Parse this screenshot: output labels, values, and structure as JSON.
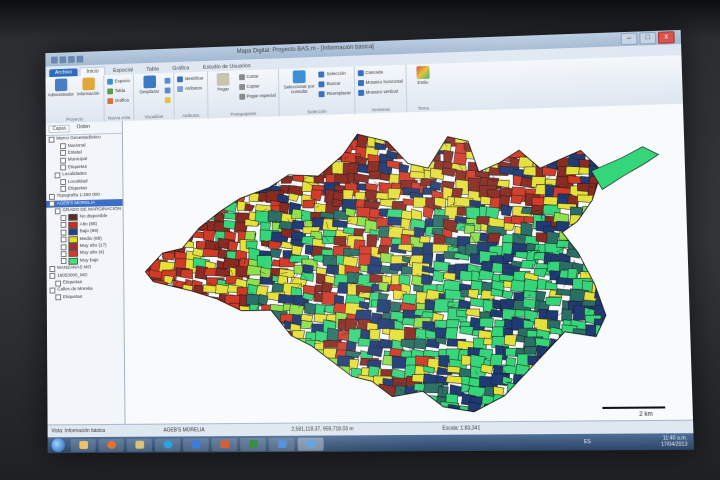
{
  "window": {
    "title": "Mapa Digital: Proyecto BAS.m - [Información básica]",
    "controls": {
      "minimize": "–",
      "maximize": "□",
      "close": "x"
    }
  },
  "ribbon_tabs": [
    "Archivo",
    "Inicio",
    "Espacial",
    "Tabla",
    "Gráfica",
    "Estudio de Usuarios"
  ],
  "ribbon": {
    "groups": [
      {
        "name": "Proyecto",
        "buttons": [
          "Administrador",
          "Información"
        ]
      },
      {
        "name": "Nueva vista",
        "buttons": [
          "Espacio",
          "Tabla",
          "Gráfica"
        ]
      },
      {
        "name": "Visualizar",
        "buttons": [
          "Desplazar"
        ]
      },
      {
        "name": "Atributos",
        "buttons": [
          "Identificar",
          "Atributos"
        ]
      },
      {
        "name": "Portapapeles",
        "buttons": [
          "Pegar",
          "Cortar",
          "Copiar",
          "Pegar especial"
        ]
      },
      {
        "name": "Selección",
        "buttons": [
          "Seleccionar por consulta",
          "Selección",
          "Buscar",
          "Reemplazar"
        ]
      },
      {
        "name": "Ventanas",
        "buttons": [
          "Cascada",
          "Mosaico horizontal",
          "Mosaico vertical"
        ]
      },
      {
        "name": "Tema",
        "buttons": [
          "Estilo"
        ]
      }
    ]
  },
  "toc": {
    "tabs": [
      "Capas",
      "Orden"
    ],
    "items": [
      {
        "label": "Marco Geoestadístico",
        "level": 0
      },
      {
        "label": "Nacional",
        "level": 2
      },
      {
        "label": "Estatal",
        "level": 2
      },
      {
        "label": "Municipal",
        "level": 2
      },
      {
        "label": "Etiquetas",
        "level": 2
      },
      {
        "label": "Localidades",
        "level": 1
      },
      {
        "label": "Localidad",
        "level": 2
      },
      {
        "label": "Etiquetas",
        "level": 2
      },
      {
        "label": "Topografía 1:250 000",
        "level": 0
      },
      {
        "label": "AGEB'S MORELIA",
        "level": 0,
        "selected": true
      },
      {
        "label": "GRADO DE MARGINACIÓN",
        "level": 1
      },
      {
        "label": "No disponible",
        "level": 2,
        "color": "#5a2a2a"
      },
      {
        "label": "Alto (88)",
        "level": 2,
        "color": "#d42a1f"
      },
      {
        "label": "Bajo (89)",
        "level": 2,
        "color": "#1f3f8c"
      },
      {
        "label": "Medio (88)",
        "level": 2,
        "color": "#e8de1e"
      },
      {
        "label": "Muy alto (17)",
        "level": 2,
        "color": "#b2282e"
      },
      {
        "label": "Muy alto (4)",
        "level": 2,
        "color": "#d83a2a"
      },
      {
        "label": "Muy bajo",
        "level": 2,
        "color": "#46e07a"
      },
      {
        "label": "MANZANAS MO",
        "level": 0
      },
      {
        "label": "16053000_MO",
        "level": 0
      },
      {
        "label": "Etiquetas",
        "level": 1
      },
      {
        "label": "Calles de Morelia",
        "level": 0
      },
      {
        "label": "Etiquetas",
        "level": 1
      }
    ]
  },
  "map": {
    "colors": {
      "dark_red": "#8a2a22",
      "red": "#d23a28",
      "yellow": "#e6e03a",
      "green": "#35d67a",
      "lime": "#8fe04a",
      "navy": "#1f3a74",
      "teal": "#2a6f66"
    },
    "scalebar_label": "2 km"
  },
  "status": {
    "left": "Vista: Información básica",
    "layer": "AGEB'S MORELIA",
    "coords": "2,581,118.37, 959,718.03 m",
    "scale": "Escala: 1:83,341"
  },
  "taskbar": {
    "apps": [
      "start",
      "explorer-icon",
      "firefox-icon",
      "folder-icon",
      "skype-icon",
      "media-icon",
      "powerpoint-icon",
      "excel-icon",
      "presentation-icon",
      "mapa-digital-icon"
    ],
    "language": "ES",
    "time": "11:40 a.m.",
    "date": "17/04/2013"
  }
}
